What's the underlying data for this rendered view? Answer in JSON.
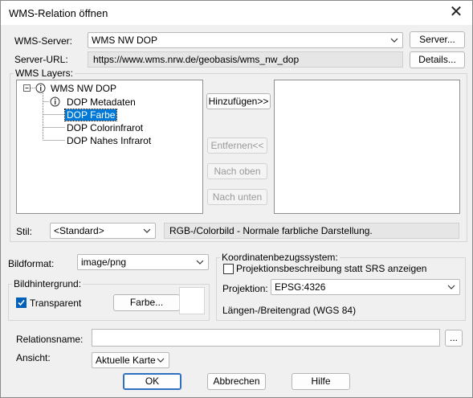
{
  "window": {
    "title": "WMS-Relation öffnen",
    "close_glyph": "✕"
  },
  "server": {
    "label": "WMS-Server:",
    "value": "WMS NW DOP",
    "button": "Server...",
    "url_label": "Server-URL:",
    "url_value": "https://www.wms.nrw.de/geobasis/wms_nw_dop",
    "details_button": "Details..."
  },
  "layers": {
    "group_label": "WMS Layers:",
    "root": "WMS NW DOP",
    "items": [
      "DOP Metadaten",
      "DOP Farbe",
      "DOP Colorinfrarot",
      "DOP Nahes Infrarot"
    ],
    "selected": "DOP Farbe",
    "add_button": "Hinzufügen>>",
    "remove_button": "Entfernen<<",
    "up_button": "Nach oben",
    "down_button": "Nach unten"
  },
  "style": {
    "label": "Stil:",
    "value": "<Standard>",
    "description": "RGB-/Colorbild - Normale farbliche Darstellung."
  },
  "image": {
    "format_label": "Bildformat:",
    "format_value": "image/png",
    "background_group": "Bildhintergrund:",
    "transparent_label": "Transparent",
    "transparent_checked": true,
    "color_button": "Farbe..."
  },
  "crs": {
    "group_label": "Koordinatenbezugssystem:",
    "projection_desc_label": "Projektionsbeschreibung statt SRS anzeigen",
    "projection_desc_checked": false,
    "projection_label": "Projektion:",
    "projection_value": "EPSG:4326",
    "projection_name": "Längen-/Breitengrad (WGS 84)"
  },
  "relation": {
    "name_label": "Relationsname:",
    "name_value": "",
    "browse_button": "...",
    "view_label": "Ansicht:",
    "view_value": "Aktuelle Karte"
  },
  "footer": {
    "ok": "OK",
    "cancel": "Abbrechen",
    "help": "Hilfe"
  },
  "colors": {
    "selection": "#0078d7",
    "default_border": "#2f6fbf",
    "check_accent": "#005fb8"
  }
}
